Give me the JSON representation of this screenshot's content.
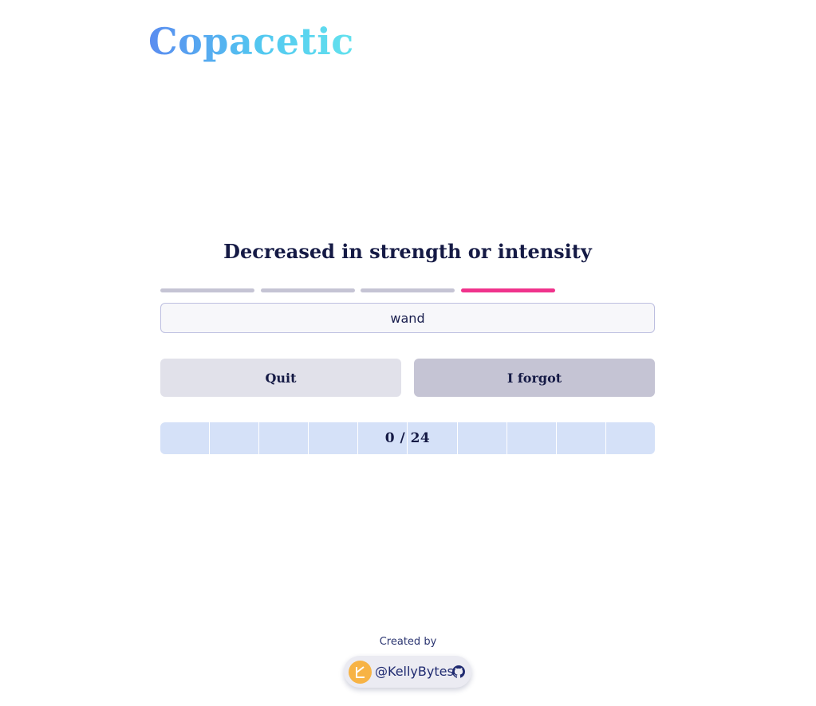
{
  "app": {
    "logo_text": "Copacetic"
  },
  "quiz": {
    "prompt": "Decreased in strength or intensity",
    "steps_total": 4,
    "current_step": 4,
    "answer_value": "wand",
    "quit_label": "Quit",
    "forgot_label": "I forgot",
    "progress_text": "0 / 24",
    "progress_completed": 0,
    "progress_total": 24
  },
  "footer": {
    "created_by_label": "Created by",
    "author_handle": "@KellyBytes",
    "avatar_icon": "kellybytes-logo-icon",
    "link_icon": "github-icon"
  },
  "colors": {
    "accent": "#f0338c",
    "step_inactive": "#c5c4d4",
    "progress_bg": "#d5e1f8",
    "text_dark": "#151a45",
    "logo_gradient_start": "#5a8cf0",
    "logo_gradient_end": "#63e2ee"
  }
}
